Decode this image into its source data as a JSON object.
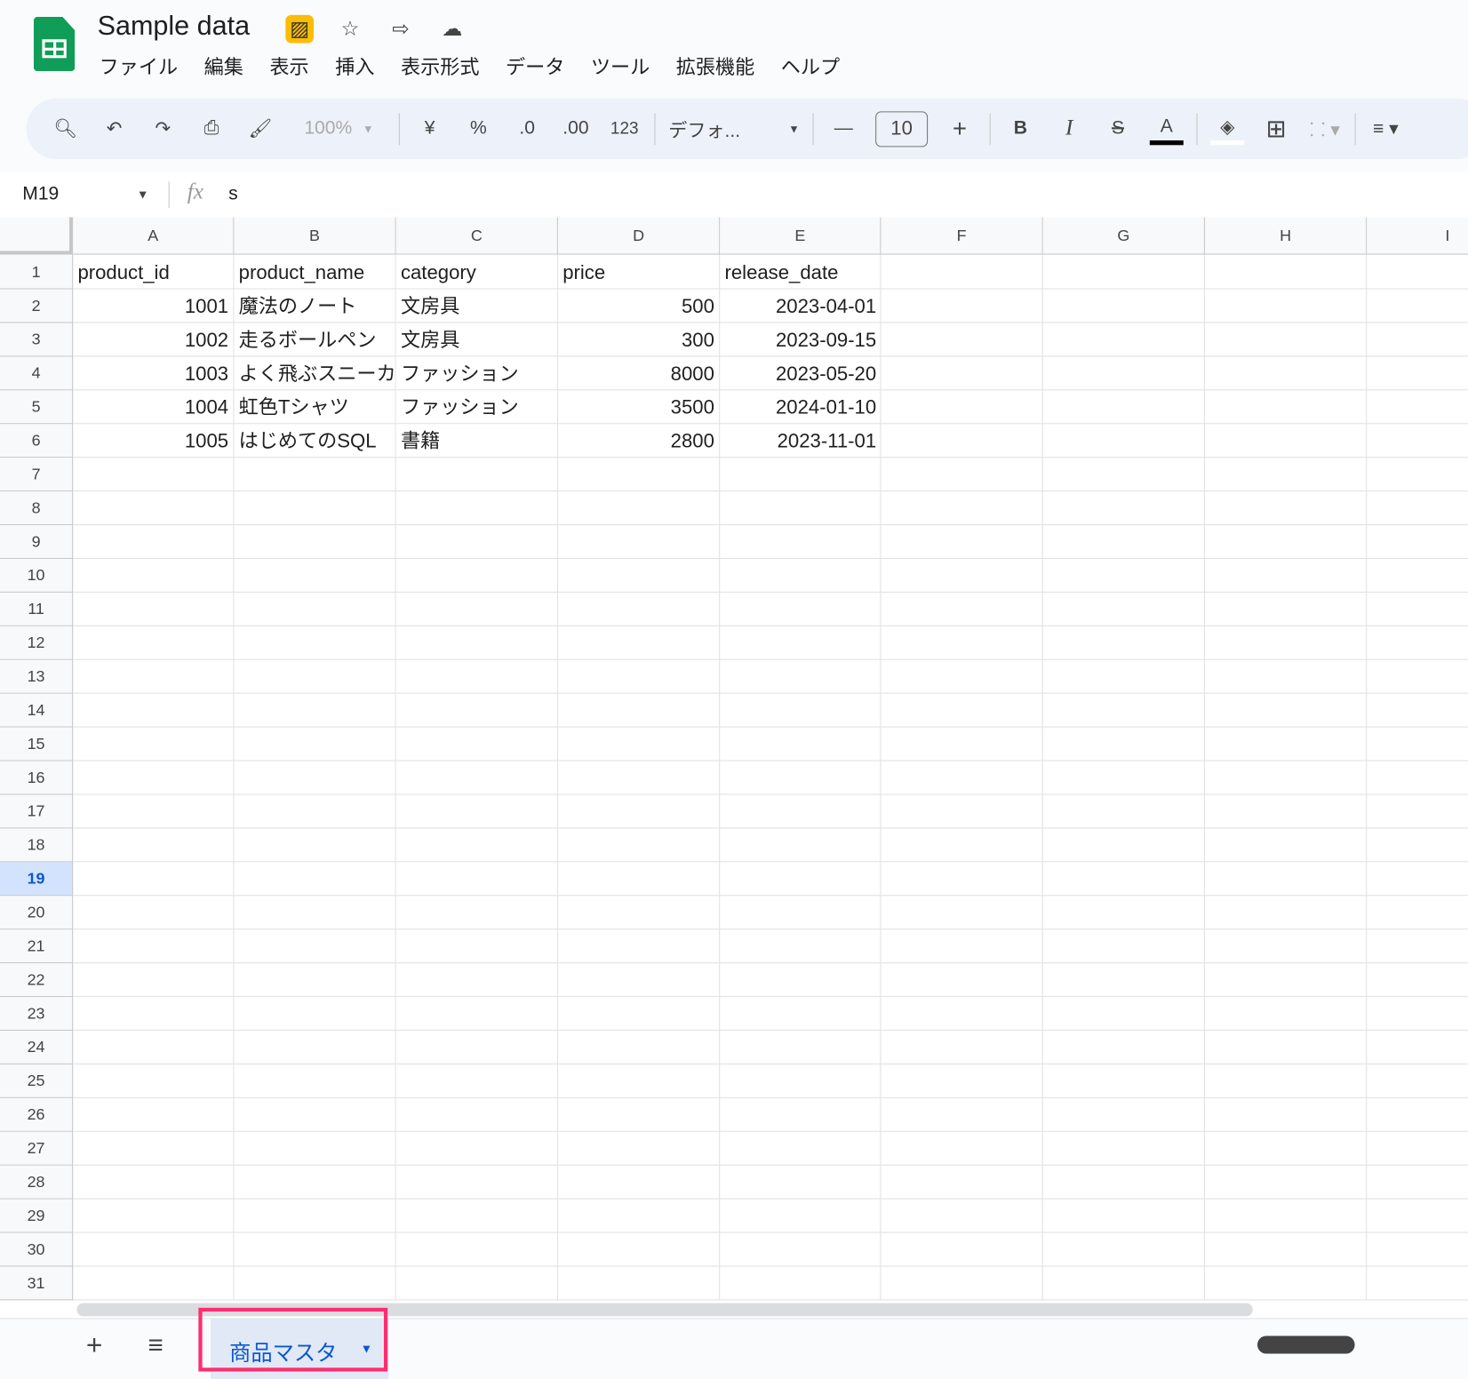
{
  "app": {
    "title": "Sample data",
    "icons": [
      "presentation-off-icon",
      "star-icon",
      "move-folder-icon",
      "cloud-saved-icon"
    ]
  },
  "menu": [
    "ファイル",
    "編集",
    "表示",
    "挿入",
    "表示形式",
    "データ",
    "ツール",
    "拡張機能",
    "ヘルプ"
  ],
  "toolbar": {
    "zoom": "100%",
    "currency": "¥",
    "percent": "%",
    "dec_decrease": ".0",
    "dec_increase": ".00",
    "number_format": "123",
    "font": "デフォ...",
    "font_size": "10",
    "bold": "B",
    "italic": "I",
    "text_color": "A"
  },
  "formula_bar": {
    "name_box": "M19",
    "fx": "fx",
    "value": "s"
  },
  "columns": [
    "A",
    "B",
    "C",
    "D",
    "E",
    "F",
    "G",
    "H",
    "I"
  ],
  "selected_row": 19,
  "row_count": 31,
  "table": {
    "headers": [
      "product_id",
      "product_name",
      "category",
      "price",
      "release_date"
    ],
    "rows": [
      [
        "1001",
        "魔法のノート",
        "文房具",
        "500",
        "2023-04-01"
      ],
      [
        "1002",
        "走るボールペン",
        "文房具",
        "300",
        "2023-09-15"
      ],
      [
        "1003",
        "よく飛ぶスニーカー",
        "ファッション",
        "8000",
        "2023-05-20"
      ],
      [
        "1004",
        "虹色Tシャツ",
        "ファッション",
        "3500",
        "2024-01-10"
      ],
      [
        "1005",
        "はじめてのSQL",
        "書籍",
        "2800",
        "2023-11-01"
      ]
    ]
  },
  "sheet_tabs": [
    {
      "label": "商品マスタ",
      "active": true
    }
  ],
  "colors": {
    "accent": "#0b57d0",
    "highlight": "#ff2d6f",
    "sheets_green": "#0f9d58"
  }
}
